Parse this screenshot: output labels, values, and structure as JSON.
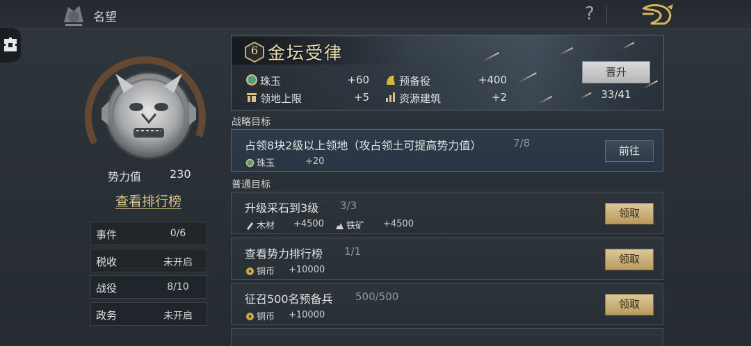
{
  "header": {
    "title": "名望"
  },
  "profile": {
    "power_label": "势力值",
    "power_value": "230",
    "ranking_link": "查看排行榜",
    "stats": [
      {
        "label": "事件",
        "value": "0/6"
      },
      {
        "label": "税收",
        "value": "未开启"
      },
      {
        "label": "战役",
        "value": "8/10"
      },
      {
        "label": "政务",
        "value": "未开启"
      }
    ]
  },
  "rank": {
    "level": "6",
    "title": "金坛受律",
    "rewards": [
      {
        "icon": "jade-icon",
        "label": "珠玉",
        "value": "+60"
      },
      {
        "icon": "reserve-troops-icon",
        "label": "预备役",
        "value": "+400"
      },
      {
        "icon": "territory-icon",
        "label": "领地上限",
        "value": "+5"
      },
      {
        "icon": "resource-building-icon",
        "label": "资源建筑",
        "value": "+2"
      }
    ],
    "promote_label": "晋升",
    "progress": "33/41"
  },
  "strategic": {
    "section_label": "战略目标",
    "task": {
      "title": "占领8块2级以上领地（攻占领土可提高势力值）",
      "progress": "7/8",
      "reward_label": "珠玉",
      "reward_value": "+20",
      "button": "前往"
    }
  },
  "normal": {
    "section_label": "普通目标",
    "tasks": [
      {
        "title": "升级采石到3级",
        "progress": "3/3",
        "rewards": [
          {
            "icon": "wood-icon",
            "label": "木材",
            "value": "+4500"
          },
          {
            "icon": "iron-ore-icon",
            "label": "铁矿",
            "value": "+4500"
          }
        ],
        "button": "领取"
      },
      {
        "title": "查看势力排行榜",
        "progress": "1/1",
        "rewards": [
          {
            "icon": "copper-coin-icon",
            "label": "铜币",
            "value": "+10000"
          }
        ],
        "button": "领取"
      },
      {
        "title": "征召500名预备兵",
        "progress": "500/500",
        "rewards": [
          {
            "icon": "copper-coin-icon",
            "label": "铜币",
            "value": "+10000"
          }
        ],
        "button": "领取"
      }
    ]
  },
  "colors": {
    "accent_gold": "#d9c58c",
    "button_gold": "#c8ad72",
    "panel_border": "#48525a"
  }
}
